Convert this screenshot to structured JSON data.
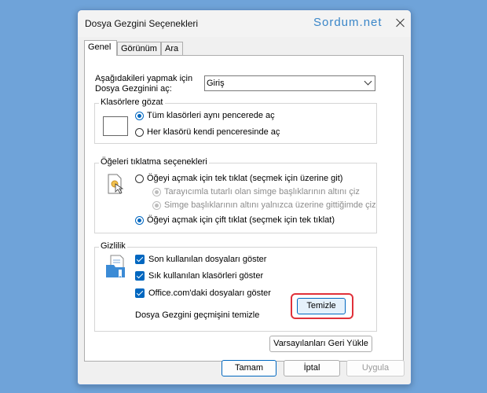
{
  "window": {
    "title": "Dosya Gezgini Seçenekleri",
    "watermark": "Sordum.net"
  },
  "tabs": [
    "Genel",
    "Görünüm",
    "Ara"
  ],
  "open_label_line1": "Aşağıdakileri yapmak için",
  "open_label_line2": "Dosya Gezginini aç:",
  "open_select_value": "Giriş",
  "browse_group": {
    "title": "Klasörlere gözat",
    "option1": "Tüm klasörleri aynı pencerede aç",
    "option2": "Her klasörü kendi penceresinde aç"
  },
  "click_group": {
    "title": "Öğeleri tıklatma seçenekleri",
    "option1": "Öğeyi açmak için tek tıklat (seçmek için üzerine git)",
    "sub1": "Tarayıcımla tutarlı olan simge başlıklarının altını çiz",
    "sub2": "Simge başlıklarının altını yalnızca üzerine gittiğimde çiz",
    "option2": "Öğeyi açmak için çift tıklat (seçmek için tek tıklat)"
  },
  "privacy_group": {
    "title": "Gizlilik",
    "check1": "Son kullanılan dosyaları göster",
    "check2": "Sık kullanılan klasörleri göster",
    "check3": "Office.com'daki dosyaları göster",
    "clear_label": "Dosya Gezgini geçmişini temizle",
    "clear_button": "Temizle"
  },
  "restore_button": "Varsayılanları Geri Yükle",
  "ok_button": "Tamam",
  "cancel_button": "İptal",
  "apply_button": "Uygula"
}
